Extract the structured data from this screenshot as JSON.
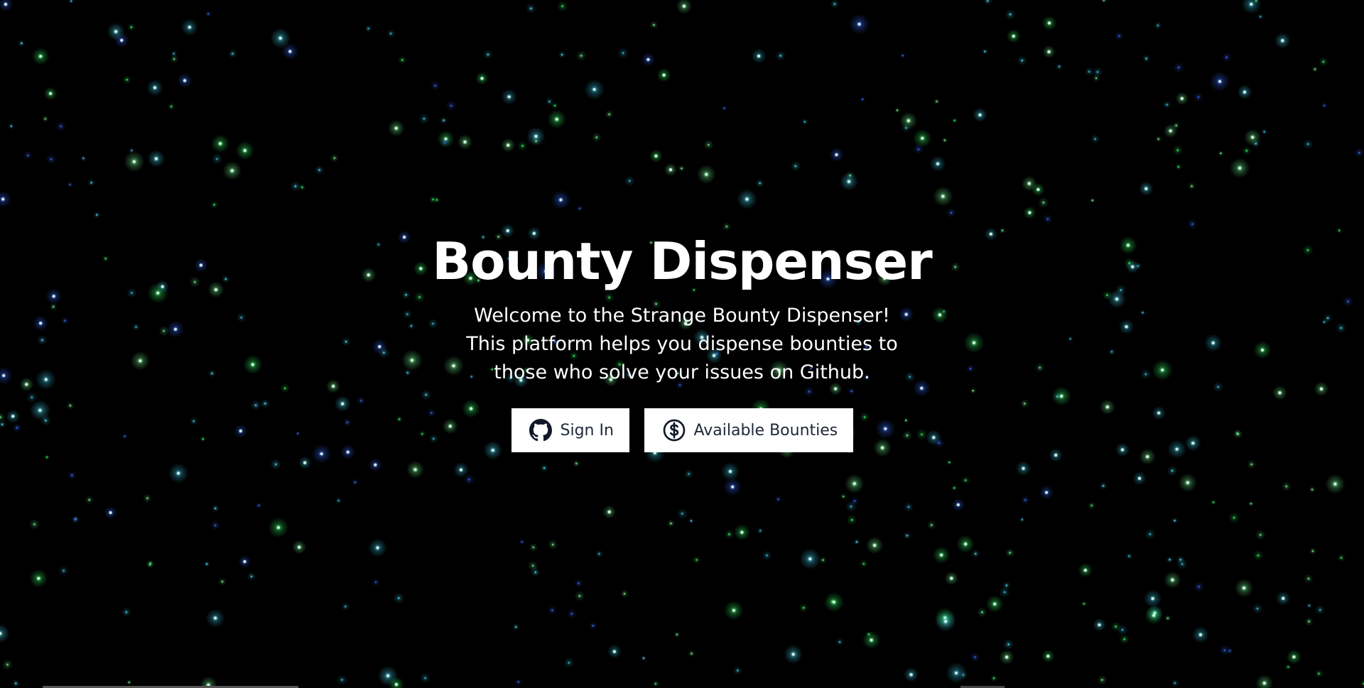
{
  "hero": {
    "title": "Bounty Dispenser",
    "subtitle_lines": [
      "Welcome to the Strange Bounty Dispenser!",
      "This platform helps you dispense bounties to",
      "those who solve your issues on Github."
    ]
  },
  "buttons": {
    "sign_in": {
      "label": "Sign In",
      "icon": "github-icon"
    },
    "available_bounties": {
      "label": "Available Bounties",
      "icon": "dollar-circle-icon"
    }
  },
  "colors": {
    "background": "#000000",
    "text": "#ffffff",
    "button_bg": "#ffffff",
    "button_text": "#1f2937",
    "star_green": "#39ff6a",
    "star_cyan": "#4fe3ff",
    "star_blue": "#3a6bff"
  }
}
